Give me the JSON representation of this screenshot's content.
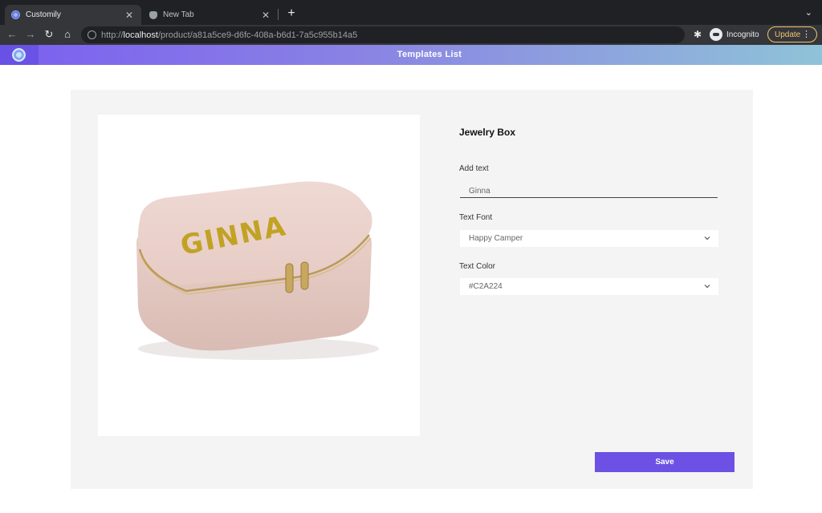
{
  "browser": {
    "tabs": [
      {
        "title": "Customily",
        "active": true
      },
      {
        "title": "New Tab",
        "active": false
      }
    ],
    "url_scheme": "http://",
    "url_host": "localhost",
    "url_path": "/product/a81a5ce9-d6fc-408a-b6d1-7a5c955b14a5",
    "profile_label": "Incognito",
    "update_label": "Update",
    "icons": {
      "close": "close-icon",
      "new_tab": "plus-icon",
      "back": "back-arrow-icon",
      "forward": "forward-arrow-icon",
      "reload": "reload-icon",
      "home": "home-icon",
      "extensions": "puzzle-icon",
      "menu": "more-vertical-icon"
    }
  },
  "app": {
    "header_title": "Templates List",
    "accent_color": "#6c51e4"
  },
  "product": {
    "title": "Jewelry Box",
    "image": {
      "subject": "Pink zippered jewelry box",
      "personalized_text": "GINNA",
      "text_color": "#C2A224",
      "box_color": "#e9cfc8"
    }
  },
  "form": {
    "add_text_label": "Add text",
    "add_text_value": "Ginna",
    "font_label": "Text Font",
    "font_value": "Happy Camper",
    "color_label": "Text Color",
    "color_value": "#C2A224",
    "save_label": "Save"
  }
}
